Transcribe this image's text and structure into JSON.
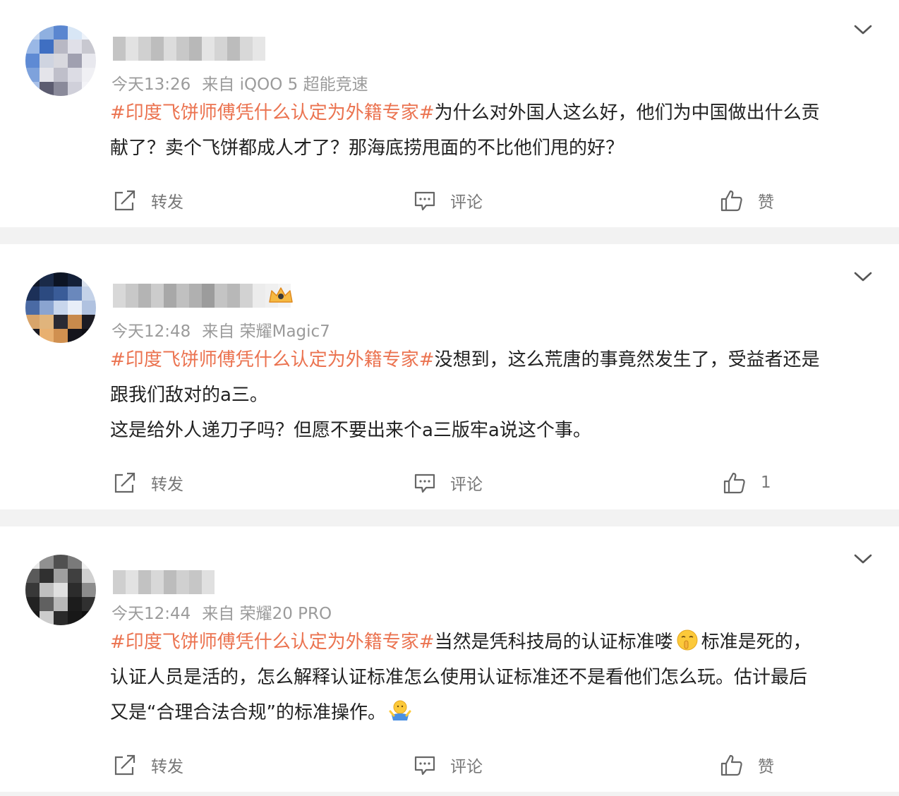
{
  "posts": [
    {
      "meta_time": "今天13:26",
      "meta_source": "来自 iQOO 5 超能竞速",
      "topic": "#印度飞饼师傅凭什么认定为外籍专家#",
      "line1_rest": "为什么对外国人这么好，他们为中国做出什么贡",
      "line2": "献了？卖个飞饼都成人才了？那海底捞甩面的不比他们甩的好？",
      "actions": {
        "repost": "转发",
        "comment": "评论",
        "like": "赞"
      }
    },
    {
      "meta_time": "今天12:48",
      "meta_source": "来自 荣耀Magic7",
      "topic": "#印度飞饼师傅凭什么认定为外籍专家#",
      "line1_rest": "没想到，这么荒唐的事竟然发生了，受益者还是",
      "line2": "跟我们敌对的a三。",
      "line3": "这是给外人递刀子吗？但愿不要出来个a三版牢a说这个事。",
      "actions": {
        "repost": "转发",
        "comment": "评论",
        "like": "1"
      }
    },
    {
      "meta_time": "今天12:44",
      "meta_source": "来自 荣耀20 PRO",
      "topic": "#印度飞饼师傅凭什么认定为外籍专家#",
      "line1_rest_a": "当然是凭科技局的认证标准喽",
      "line1_rest_b": "标准是死的，",
      "line2": "认证人员是活的，怎么解释认证标准怎么使用认证标准还不是看他们怎么玩。估计最后",
      "line3": "又是“合理合法合规”的标准操作。",
      "emoji_1": "shush-face-emoji",
      "emoji_2": "shrug-emoji",
      "actions": {
        "repost": "转发",
        "comment": "评论",
        "like": "赞"
      }
    }
  ],
  "colors": {
    "topic": "#eb7350",
    "text": "#222222",
    "meta": "#9b9b9b",
    "action": "#777777",
    "separator": "#f2f2f2"
  }
}
